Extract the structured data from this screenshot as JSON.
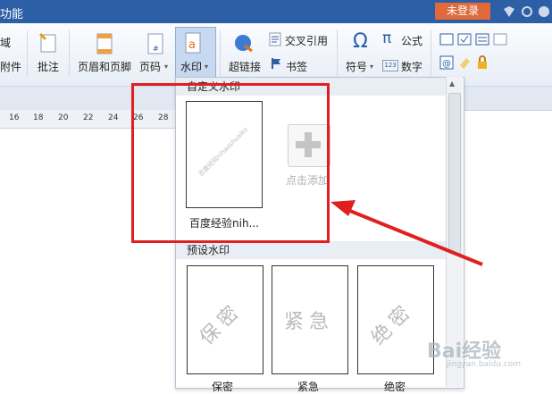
{
  "titlebar": {
    "title": "功能",
    "login_label": "未登录"
  },
  "ribbon": {
    "left_top": "域",
    "left_bottom": "附件",
    "annotation": "批注",
    "header_footer": "页眉和页脚",
    "page_number": "页码",
    "watermark": "水印",
    "hyperlink": "超链接",
    "cross_ref": "交叉引用",
    "bookmark": "书签",
    "symbol": "符号",
    "formula": "公式",
    "number": "数字"
  },
  "ruler": {
    "ticks": [
      "16",
      "18",
      "20",
      "22",
      "24",
      "26",
      "28"
    ]
  },
  "panel": {
    "custom_heading": "自定义水印",
    "custom_item_caption": "百度经验nih...",
    "custom_item_watermark_text": "百度经验nihaoshuaiko",
    "add_label": "点击添加",
    "preset_heading": "预设水印",
    "presets": [
      {
        "watermark": "保密",
        "caption": "保密"
      },
      {
        "watermark": "紧急",
        "caption": "紧急"
      },
      {
        "watermark": "绝密",
        "caption": "绝密"
      }
    ]
  },
  "logo": {
    "text": "Bai经验",
    "sub": "jingyan.baidu.com"
  },
  "colors": {
    "titlebar": "#2d5fa6",
    "login": "#e06a3a",
    "highlight": "#e02020"
  }
}
